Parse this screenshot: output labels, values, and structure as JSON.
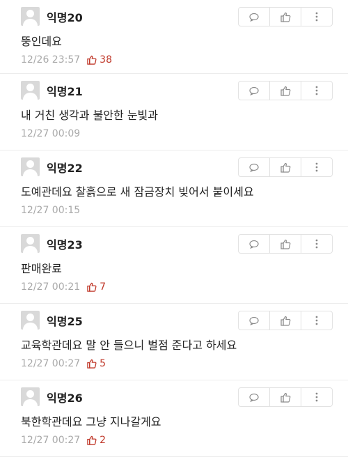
{
  "comments": [
    {
      "author": "익명20",
      "text": "뚱인데요",
      "time": "12/26 23:57",
      "likes": "38"
    },
    {
      "author": "익명21",
      "text": "내 거친 생각과 불안한 눈빛과",
      "time": "12/27 00:09",
      "likes": ""
    },
    {
      "author": "익명22",
      "text": "도예관데요 찰흙으로 새 잠금장치 빚어서 붙이세요",
      "time": "12/27 00:15",
      "likes": ""
    },
    {
      "author": "익명23",
      "text": "판매완료",
      "time": "12/27 00:21",
      "likes": "7"
    },
    {
      "author": "익명25",
      "text": "교육학관데요 말 안 들으니 벌점 준다고 하세요",
      "time": "12/27 00:27",
      "likes": "5"
    },
    {
      "author": "익명26",
      "text": "북한학관데요 그냥 지나갈게요",
      "time": "12/27 00:27",
      "likes": "2"
    }
  ],
  "icons": {
    "reply": "speech-bubble-icon",
    "like": "thumbs-up-icon",
    "more": "more-vertical-icon"
  },
  "colors": {
    "like_count": "#c0392b",
    "meta_text": "#a8a8a8",
    "divider": "#ececec"
  }
}
